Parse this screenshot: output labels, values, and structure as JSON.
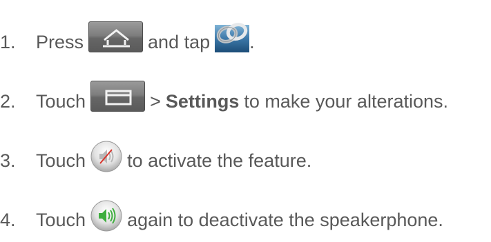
{
  "steps": [
    {
      "number": "1.",
      "parts": {
        "before": "Press",
        "icon1": "home-key-icon",
        "middle": "and tap",
        "icon2": "link-app-icon",
        "after": "."
      }
    },
    {
      "number": "2.",
      "parts": {
        "before": "Touch",
        "icon1": "menu-key-icon",
        "middle": ">",
        "bold": "Settings",
        "after": "to make your alterations."
      }
    },
    {
      "number": "3.",
      "parts": {
        "before": "Touch",
        "icon1": "speaker-off-icon",
        "after": "to activate the feature."
      }
    },
    {
      "number": "4.",
      "parts": {
        "before": "Touch",
        "icon1": "speaker-on-icon",
        "after": "again to deactivate the speakerphone."
      }
    }
  ],
  "colors": {
    "text": "#595959",
    "key_gray": "#7e7e7e",
    "speaker_green": "#3fae3f",
    "speaker_off_red": "#d9342b"
  }
}
